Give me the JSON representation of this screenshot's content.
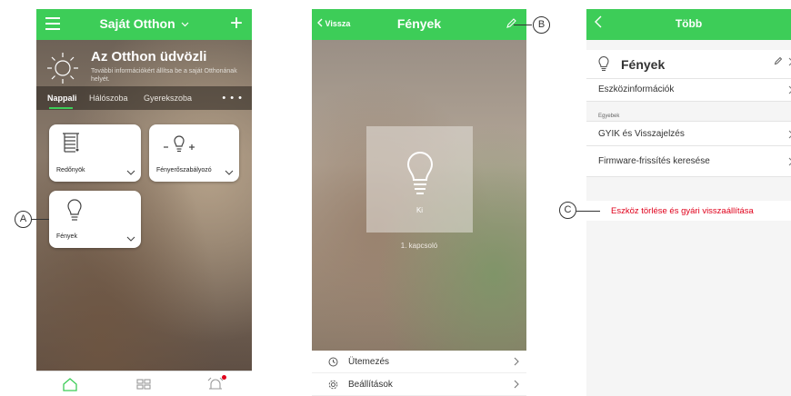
{
  "phone_home": {
    "title": "Saját Otthon",
    "welcome_title": "Az Otthon üdvözli",
    "welcome_subtitle": "További információkért állítsa be a saját Otthonának helyét.",
    "room_tabs": [
      "Nappali",
      "Hálószoba",
      "Gyerekszoba"
    ],
    "active_tab": "Nappali",
    "devices": [
      {
        "label": "Redőnyök",
        "icon": "blinds-icon"
      },
      {
        "label": "Fényerőszabályozó",
        "icon": "dimmer-icon"
      },
      {
        "label": "Fények",
        "icon": "lightbulb-icon"
      }
    ],
    "bottom_nav": [
      "home-icon",
      "grid-icon",
      "alarm-bell-icon"
    ]
  },
  "phone_lights": {
    "back_label": "Vissza",
    "title": "Fények",
    "state": "Ki",
    "switch_name": "1. kapcsoló",
    "menu": [
      {
        "label": "Ütemezés",
        "icon": "clock-icon"
      },
      {
        "label": "Beállítások",
        "icon": "gear-icon"
      }
    ]
  },
  "phone_more": {
    "title": "Több",
    "device_name": "Fények",
    "device_info": "Eszközinformációk",
    "section_other": "Egyebek",
    "faq": "GYIK és Visszajelzés",
    "firmware": "Firmware-frissítés keresése",
    "delete_reset": "Eszköz törlése és gyári visszaállítása"
  },
  "callouts": {
    "a": "A",
    "b": "B",
    "c": "C"
  },
  "colors": {
    "accent": "#3dcd58",
    "danger": "#e0001b"
  }
}
